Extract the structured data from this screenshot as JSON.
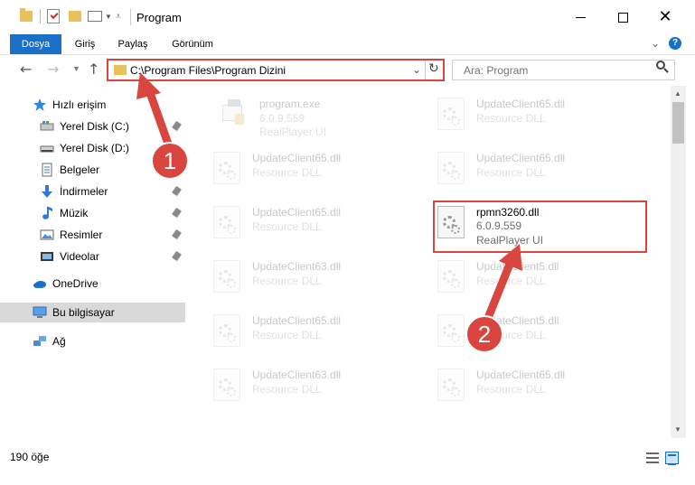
{
  "window": {
    "title": "Program"
  },
  "ribbon": {
    "tabs": [
      {
        "label": "Dosya"
      },
      {
        "label": "Giriş"
      },
      {
        "label": "Paylaş"
      },
      {
        "label": "Görünüm"
      }
    ],
    "help_label": "?"
  },
  "address": {
    "path": "C:\\Program Files\\Program Dizini"
  },
  "search": {
    "placeholder": "Ara: Program"
  },
  "navpane": {
    "items": [
      {
        "label": "Hızlı erişim",
        "icon": "star-icon"
      },
      {
        "label": "Yerel Disk (C:)",
        "icon": "drive-icon"
      },
      {
        "label": "Yerel Disk (D:)",
        "icon": "drive-icon"
      },
      {
        "label": "Belgeler",
        "icon": "documents-icon"
      },
      {
        "label": "İndirmeler",
        "icon": "download-icon"
      },
      {
        "label": "Müzik",
        "icon": "music-icon"
      },
      {
        "label": "Resimler",
        "icon": "pictures-icon"
      },
      {
        "label": "Videolar",
        "icon": "videos-icon"
      },
      {
        "label": "OneDrive",
        "icon": "cloud-icon"
      },
      {
        "label": "Bu bilgisayar",
        "icon": "computer-icon"
      },
      {
        "label": "Ağ",
        "icon": "network-icon"
      }
    ]
  },
  "files": [
    {
      "name": "program.exe",
      "version": "6.0.9.559",
      "description": "RealPlayer UI"
    },
    {
      "name": "UpdateClient65.dll",
      "description": "Resource DLL"
    },
    {
      "name": "UpdateClient65.dll",
      "description": "Resource DLL"
    },
    {
      "name": "UpdateClient65.dll",
      "description": "Resource DLL"
    },
    {
      "name": "UpdateClient65.dll",
      "description": "Resource DLL"
    },
    {
      "name": "rpmn3260.dll",
      "version": "6.0.9.559",
      "description": "RealPlayer UI"
    },
    {
      "name": "UpdateClient63.dll",
      "description": "Resource DLL"
    },
    {
      "name": "UpdateClient5.dll",
      "description": "Resource DLL"
    },
    {
      "name": "UpdateClient65.dll",
      "description": "Resource DLL"
    },
    {
      "name": "UpdateClient5.dll",
      "description": "Resource DLL"
    },
    {
      "name": "UpdateClient63.dll",
      "description": "Resource DLL"
    },
    {
      "name": "UpdateClient65.dll",
      "description": "Resource DLL"
    }
  ],
  "status": {
    "item_count": "190 öğe"
  },
  "annotations": {
    "marker1": "1",
    "marker2": "2",
    "color": "#d9463f"
  }
}
